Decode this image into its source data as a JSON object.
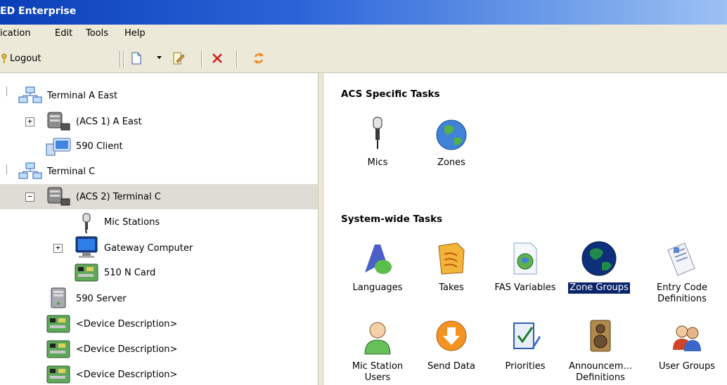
{
  "window": {
    "title": "ED Enterprise"
  },
  "menu": {
    "items": [
      "ication",
      "Edit",
      "Tools",
      "Help"
    ]
  },
  "toolbar": {
    "logout_label": "Logout"
  },
  "tree": {
    "nodes": [
      {
        "label": "Terminal A East"
      },
      {
        "label": "(ACS 1) A East",
        "expander": "+"
      },
      {
        "label": "590 Client"
      },
      {
        "label": "Terminal C"
      },
      {
        "label": "(ACS 2) Terminal C",
        "expander": "−",
        "selected": true
      },
      {
        "label": "Mic Stations"
      },
      {
        "label": "Gateway Computer",
        "expander": "+"
      },
      {
        "label": "510 N Card"
      },
      {
        "label": "590 Server"
      },
      {
        "label": "<Device Description>"
      },
      {
        "label": "<Device Description>"
      },
      {
        "label": "<Device Description>"
      }
    ]
  },
  "tasks": {
    "acs_title": "ACS Specific Tasks",
    "acs": [
      {
        "label": "Mics"
      },
      {
        "label": "Zones"
      }
    ],
    "system_title": "System-wide Tasks",
    "system": [
      {
        "label": "Languages"
      },
      {
        "label": "Takes"
      },
      {
        "label": "FAS Variables"
      },
      {
        "label": "Zone Groups",
        "selected": true
      },
      {
        "label": "Entry Code Definitions"
      },
      {
        "label": "Mic Station Users"
      },
      {
        "label": "Send Data"
      },
      {
        "label": "Priorities"
      },
      {
        "label": "Announcem... Definitions"
      },
      {
        "label": "User Groups"
      }
    ]
  }
}
